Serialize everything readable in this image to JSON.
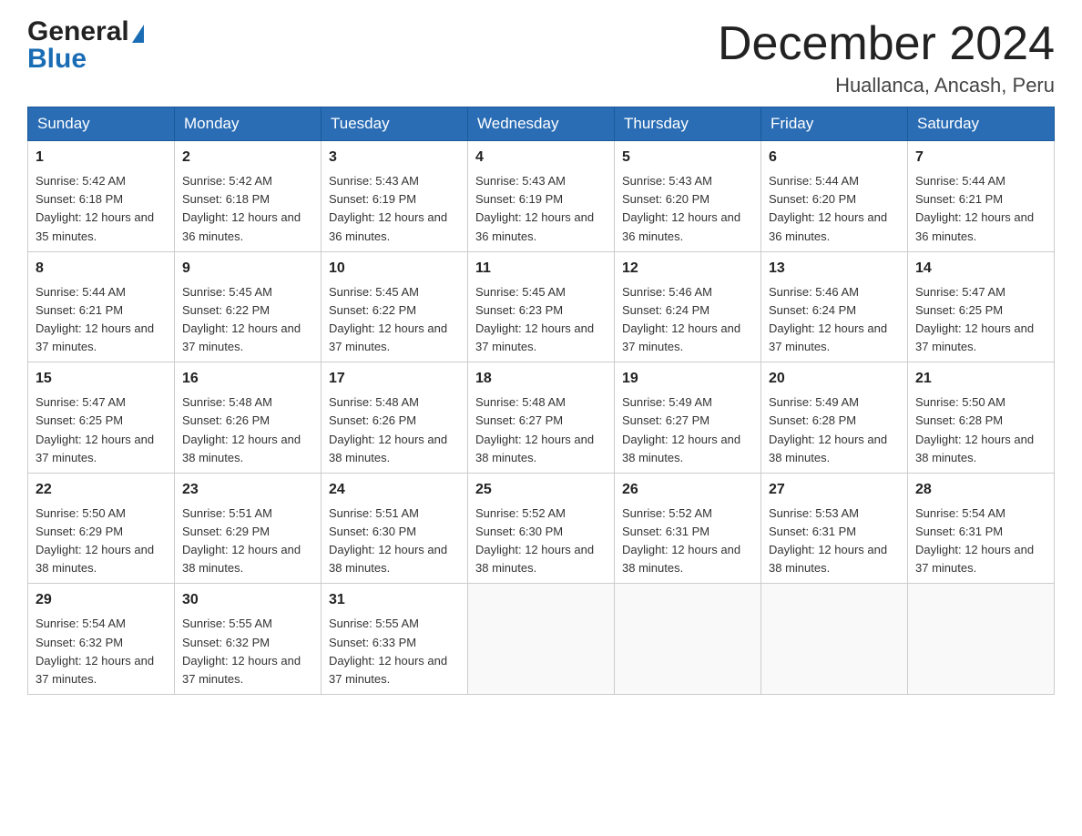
{
  "header": {
    "logo_general": "General",
    "logo_blue": "Blue",
    "month_title": "December 2024",
    "location": "Huallanca, Ancash, Peru"
  },
  "weekdays": [
    "Sunday",
    "Monday",
    "Tuesday",
    "Wednesday",
    "Thursday",
    "Friday",
    "Saturday"
  ],
  "weeks": [
    [
      {
        "day": "1",
        "sunrise": "5:42 AM",
        "sunset": "6:18 PM",
        "daylight": "12 hours and 35 minutes."
      },
      {
        "day": "2",
        "sunrise": "5:42 AM",
        "sunset": "6:18 PM",
        "daylight": "12 hours and 36 minutes."
      },
      {
        "day": "3",
        "sunrise": "5:43 AM",
        "sunset": "6:19 PM",
        "daylight": "12 hours and 36 minutes."
      },
      {
        "day": "4",
        "sunrise": "5:43 AM",
        "sunset": "6:19 PM",
        "daylight": "12 hours and 36 minutes."
      },
      {
        "day": "5",
        "sunrise": "5:43 AM",
        "sunset": "6:20 PM",
        "daylight": "12 hours and 36 minutes."
      },
      {
        "day": "6",
        "sunrise": "5:44 AM",
        "sunset": "6:20 PM",
        "daylight": "12 hours and 36 minutes."
      },
      {
        "day": "7",
        "sunrise": "5:44 AM",
        "sunset": "6:21 PM",
        "daylight": "12 hours and 36 minutes."
      }
    ],
    [
      {
        "day": "8",
        "sunrise": "5:44 AM",
        "sunset": "6:21 PM",
        "daylight": "12 hours and 37 minutes."
      },
      {
        "day": "9",
        "sunrise": "5:45 AM",
        "sunset": "6:22 PM",
        "daylight": "12 hours and 37 minutes."
      },
      {
        "day": "10",
        "sunrise": "5:45 AM",
        "sunset": "6:22 PM",
        "daylight": "12 hours and 37 minutes."
      },
      {
        "day": "11",
        "sunrise": "5:45 AM",
        "sunset": "6:23 PM",
        "daylight": "12 hours and 37 minutes."
      },
      {
        "day": "12",
        "sunrise": "5:46 AM",
        "sunset": "6:24 PM",
        "daylight": "12 hours and 37 minutes."
      },
      {
        "day": "13",
        "sunrise": "5:46 AM",
        "sunset": "6:24 PM",
        "daylight": "12 hours and 37 minutes."
      },
      {
        "day": "14",
        "sunrise": "5:47 AM",
        "sunset": "6:25 PM",
        "daylight": "12 hours and 37 minutes."
      }
    ],
    [
      {
        "day": "15",
        "sunrise": "5:47 AM",
        "sunset": "6:25 PM",
        "daylight": "12 hours and 37 minutes."
      },
      {
        "day": "16",
        "sunrise": "5:48 AM",
        "sunset": "6:26 PM",
        "daylight": "12 hours and 38 minutes."
      },
      {
        "day": "17",
        "sunrise": "5:48 AM",
        "sunset": "6:26 PM",
        "daylight": "12 hours and 38 minutes."
      },
      {
        "day": "18",
        "sunrise": "5:48 AM",
        "sunset": "6:27 PM",
        "daylight": "12 hours and 38 minutes."
      },
      {
        "day": "19",
        "sunrise": "5:49 AM",
        "sunset": "6:27 PM",
        "daylight": "12 hours and 38 minutes."
      },
      {
        "day": "20",
        "sunrise": "5:49 AM",
        "sunset": "6:28 PM",
        "daylight": "12 hours and 38 minutes."
      },
      {
        "day": "21",
        "sunrise": "5:50 AM",
        "sunset": "6:28 PM",
        "daylight": "12 hours and 38 minutes."
      }
    ],
    [
      {
        "day": "22",
        "sunrise": "5:50 AM",
        "sunset": "6:29 PM",
        "daylight": "12 hours and 38 minutes."
      },
      {
        "day": "23",
        "sunrise": "5:51 AM",
        "sunset": "6:29 PM",
        "daylight": "12 hours and 38 minutes."
      },
      {
        "day": "24",
        "sunrise": "5:51 AM",
        "sunset": "6:30 PM",
        "daylight": "12 hours and 38 minutes."
      },
      {
        "day": "25",
        "sunrise": "5:52 AM",
        "sunset": "6:30 PM",
        "daylight": "12 hours and 38 minutes."
      },
      {
        "day": "26",
        "sunrise": "5:52 AM",
        "sunset": "6:31 PM",
        "daylight": "12 hours and 38 minutes."
      },
      {
        "day": "27",
        "sunrise": "5:53 AM",
        "sunset": "6:31 PM",
        "daylight": "12 hours and 38 minutes."
      },
      {
        "day": "28",
        "sunrise": "5:54 AM",
        "sunset": "6:31 PM",
        "daylight": "12 hours and 37 minutes."
      }
    ],
    [
      {
        "day": "29",
        "sunrise": "5:54 AM",
        "sunset": "6:32 PM",
        "daylight": "12 hours and 37 minutes."
      },
      {
        "day": "30",
        "sunrise": "5:55 AM",
        "sunset": "6:32 PM",
        "daylight": "12 hours and 37 minutes."
      },
      {
        "day": "31",
        "sunrise": "5:55 AM",
        "sunset": "6:33 PM",
        "daylight": "12 hours and 37 minutes."
      },
      null,
      null,
      null,
      null
    ]
  ],
  "labels": {
    "sunrise_prefix": "Sunrise: ",
    "sunset_prefix": "Sunset: ",
    "daylight_prefix": "Daylight: "
  }
}
